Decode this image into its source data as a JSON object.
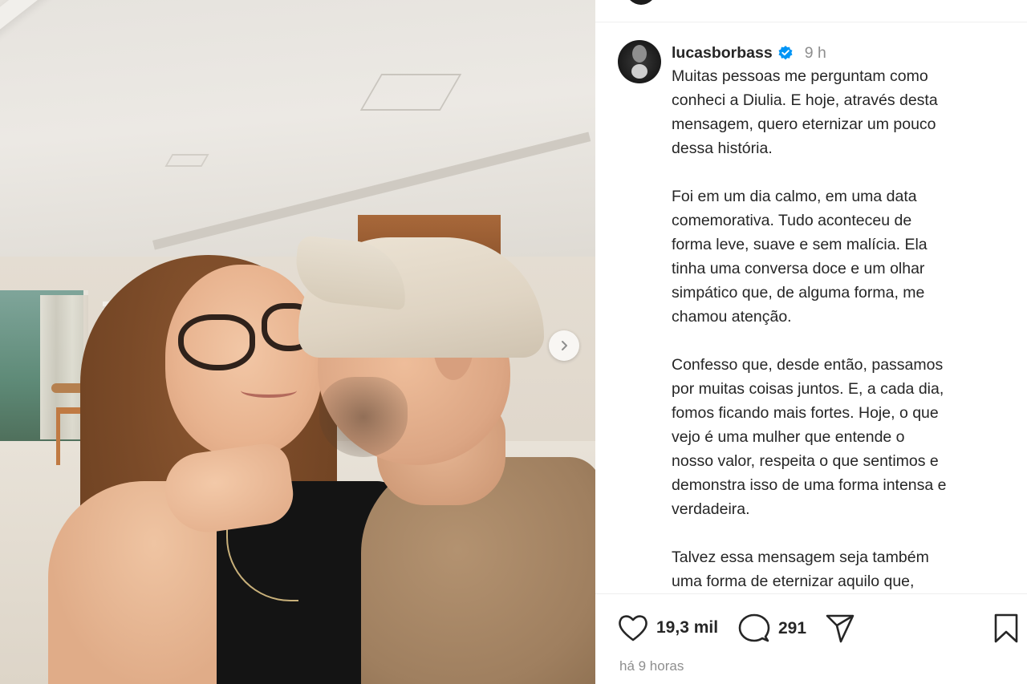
{
  "post": {
    "username": "lucasborbass",
    "time": "9 h",
    "caption_paragraphs": [
      "Muitas pessoas me perguntam como\nconheci a Diulia. E hoje, através desta\nmensagem, quero eternizar um pouco\ndessa história.",
      "Foi em um dia calmo, em uma data\ncomemorativa. Tudo aconteceu de\nforma leve, suave e sem malícia. Ela\ntinha uma conversa doce e um olhar\nsimpático que, de alguma forma, me\nchamou atenção.",
      "Confesso que, desde então, passamos\npor muitas coisas juntos. E, a cada dia,\nfomos ficando mais fortes. Hoje, o que\nvejo é uma mulher que entende o\nnosso valor, respeita o que sentimos e\ndemonstra isso de uma forma intensa e\nverdadeira.",
      "Talvez essa mensagem seja também\numa forma de eternizar aquilo que,"
    ],
    "likes": "19,3 mil",
    "comments": "291",
    "posted_ago": "há 9 horas"
  },
  "icons": {
    "verified": "verified-badge-icon",
    "like": "heart-icon",
    "comment": "comment-bubble-icon",
    "share": "paper-plane-icon",
    "save": "bookmark-icon",
    "next": "chevron-right-icon"
  },
  "colors": {
    "verified_blue": "#0095f6",
    "text": "#262626",
    "muted": "#8e8e8e"
  }
}
